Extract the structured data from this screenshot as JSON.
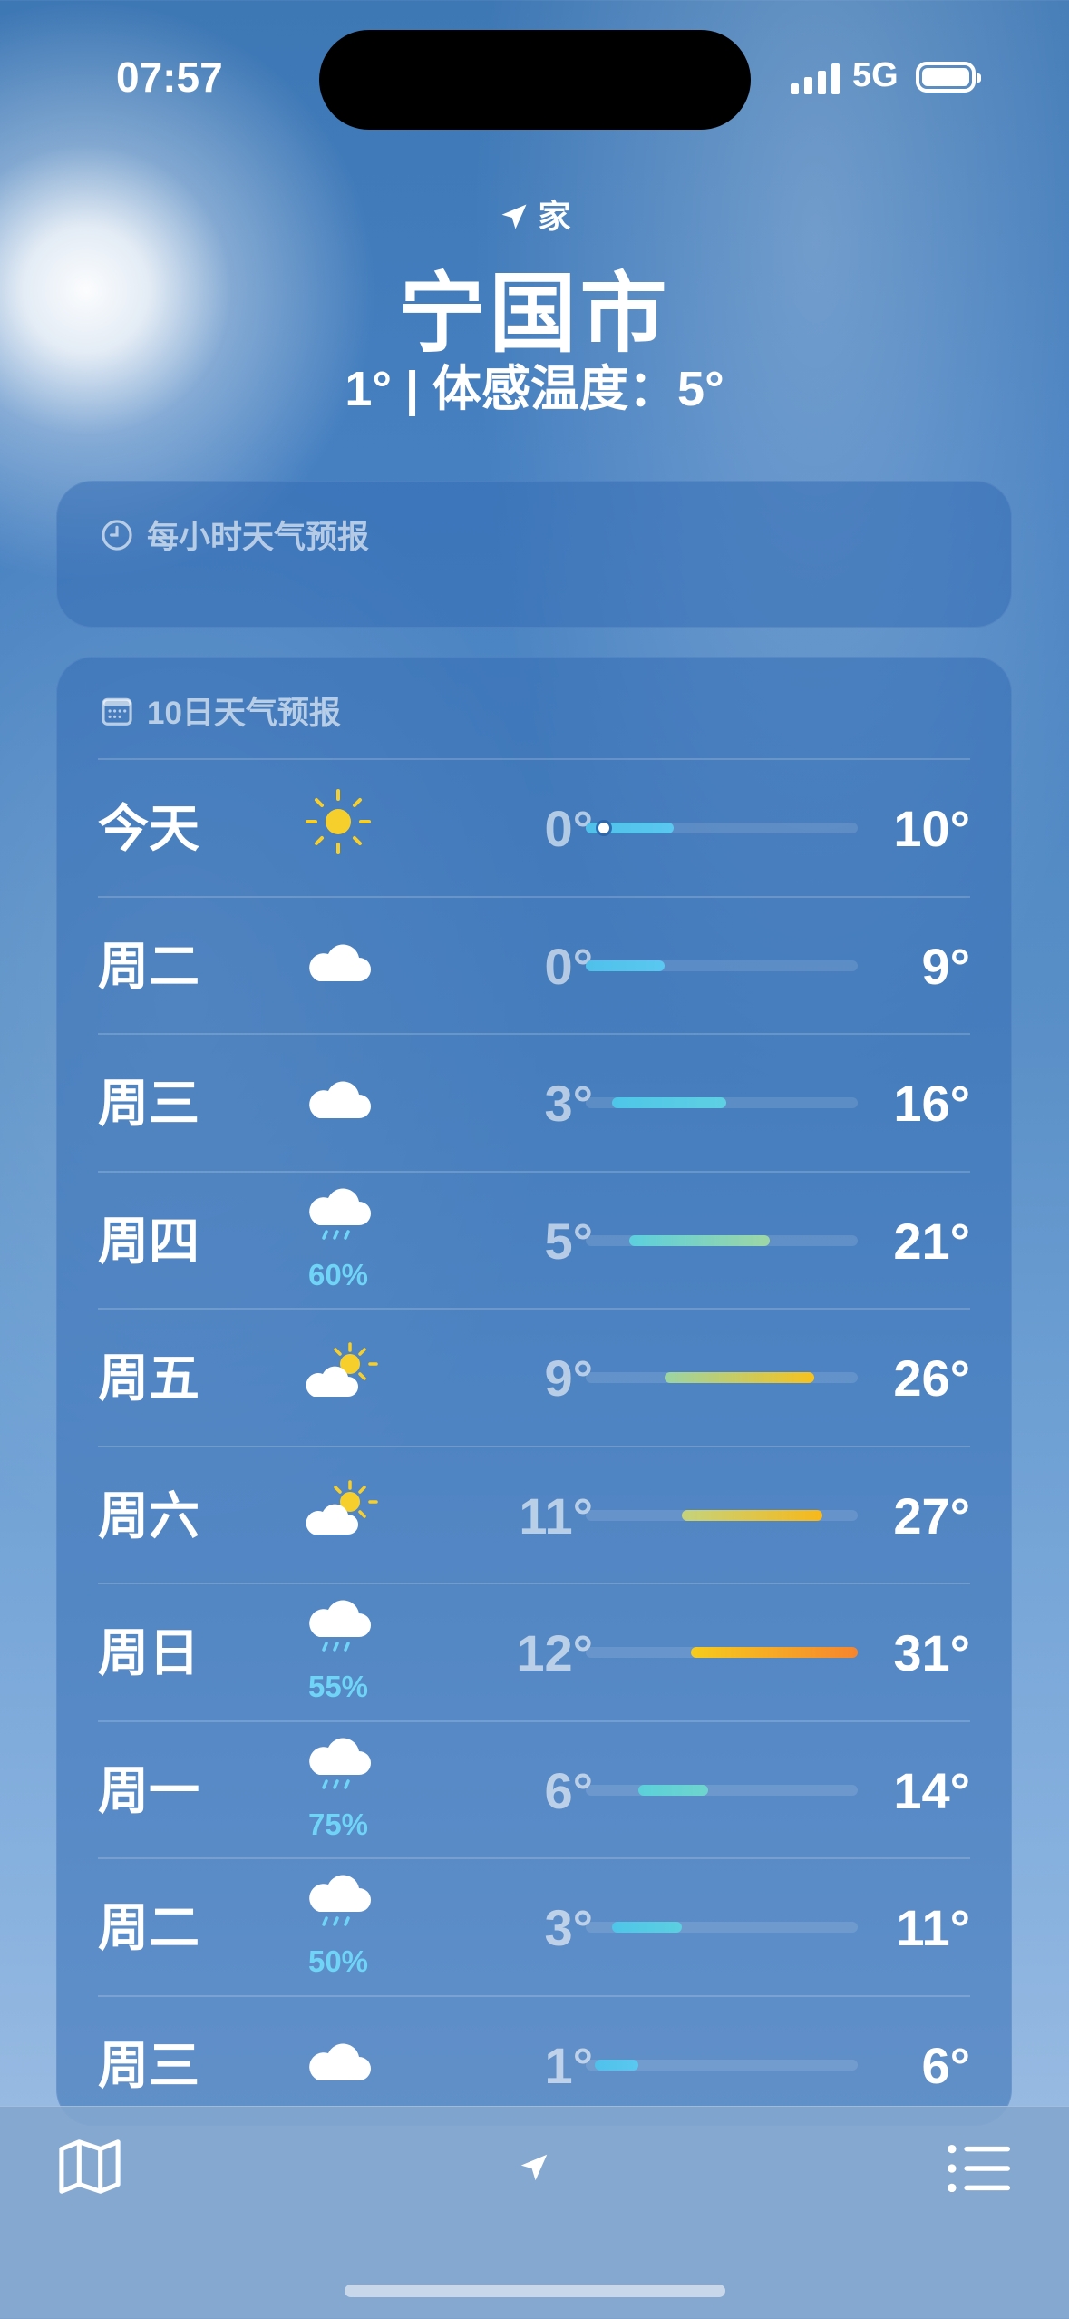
{
  "status_bar": {
    "time": "07:57",
    "network": "5G"
  },
  "header": {
    "location_label": "家",
    "city": "宁国市",
    "temp_line": "1° | 体感温度：5°"
  },
  "hourly_card": {
    "title": "每小时天气预报"
  },
  "daily_card": {
    "title": "10日天气预报",
    "temp_range": [
      0,
      31
    ],
    "rows": [
      {
        "day": "今天",
        "icon": "sun-icon",
        "precip": "",
        "lo": "0°",
        "hi": "10°",
        "lo_val": 0,
        "hi_val": 10,
        "current_val": 1,
        "colors": [
          "#4fc1ea",
          "#5ac8f0"
        ]
      },
      {
        "day": "周二",
        "icon": "cloud-icon",
        "precip": "",
        "lo": "0°",
        "hi": "9°",
        "lo_val": 0,
        "hi_val": 9,
        "colors": [
          "#4fc1ea",
          "#5ac8f0"
        ]
      },
      {
        "day": "周三",
        "icon": "cloud-icon",
        "precip": "",
        "lo": "3°",
        "hi": "16°",
        "lo_val": 3,
        "hi_val": 16,
        "colors": [
          "#4ec6e8",
          "#5fd0e3"
        ]
      },
      {
        "day": "周四",
        "icon": "rain-cloud-icon",
        "precip": "60%",
        "lo": "5°",
        "hi": "21°",
        "lo_val": 5,
        "hi_val": 21,
        "colors": [
          "#5ccfde",
          "#9ed6a5"
        ]
      },
      {
        "day": "周五",
        "icon": "partly-cloudy-icon",
        "precip": "",
        "lo": "9°",
        "hi": "26°",
        "lo_val": 9,
        "hi_val": 26,
        "colors": [
          "#9bd4a5",
          "#f7c21d"
        ]
      },
      {
        "day": "周六",
        "icon": "partly-cloudy-icon",
        "precip": "",
        "lo": "11°",
        "hi": "27°",
        "lo_val": 11,
        "hi_val": 27,
        "colors": [
          "#c5d37c",
          "#f7b81b"
        ]
      },
      {
        "day": "周日",
        "icon": "rain-cloud-icon",
        "precip": "55%",
        "lo": "12°",
        "hi": "31°",
        "lo_val": 12,
        "hi_val": 31,
        "colors": [
          "#f6cc1d",
          "#f6852e"
        ]
      },
      {
        "day": "周一",
        "icon": "rain-cloud-icon",
        "precip": "75%",
        "lo": "6°",
        "hi": "14°",
        "lo_val": 6,
        "hi_val": 14,
        "colors": [
          "#5bd0da",
          "#6fd4cd"
        ]
      },
      {
        "day": "周二",
        "icon": "rain-cloud-icon",
        "precip": "50%",
        "lo": "3°",
        "hi": "11°",
        "lo_val": 3,
        "hi_val": 11,
        "colors": [
          "#4ec6e8",
          "#5ccfe0"
        ]
      },
      {
        "day": "周三",
        "icon": "cloud-icon",
        "precip": "",
        "lo": "1°",
        "hi": "6°",
        "lo_val": 1,
        "hi_val": 6,
        "colors": [
          "#4fc1ea",
          "#5ac8f0"
        ]
      }
    ]
  },
  "toolbar": {
    "left": "map-icon",
    "center": "location-arrow-icon",
    "right": "list-icon"
  }
}
